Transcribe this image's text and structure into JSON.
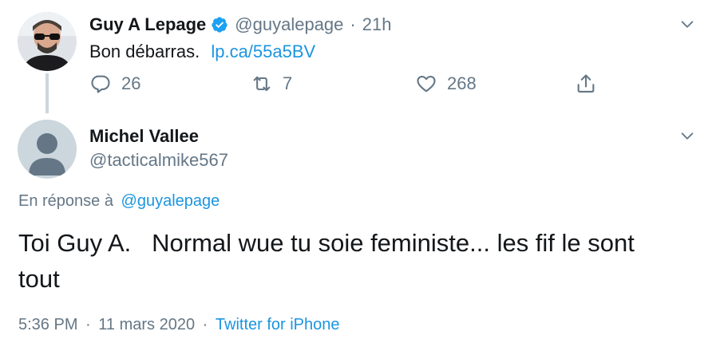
{
  "tweet1": {
    "display_name": "Guy A Lepage",
    "handle": "@guyalepage",
    "separator": "·",
    "time": "21h",
    "text": "Bon débarras.",
    "link": "lp.ca/55a5BV",
    "replies": "26",
    "retweets": "7",
    "likes": "268"
  },
  "tweet2": {
    "display_name": "Michel Vallee",
    "handle": "@tacticalmike567",
    "reply_prefix": "En réponse à",
    "reply_to": "@guyalepage",
    "text_line1": "Toi Guy A.   Normal wue tu soie feministe... les fif le sont",
    "text_line2": "tout",
    "time": "5:36 PM",
    "separator": "·",
    "date": "11 mars 2020",
    "separator2": "·",
    "source": "Twitter for iPhone"
  },
  "colors": {
    "accent": "#1b95e0",
    "muted": "#657786",
    "verified": "#1da1f2"
  },
  "icons": [
    "verified-badge-icon",
    "caret-down-icon",
    "reply-icon",
    "retweet-icon",
    "like-icon",
    "share-icon",
    "default-avatar-icon"
  ]
}
